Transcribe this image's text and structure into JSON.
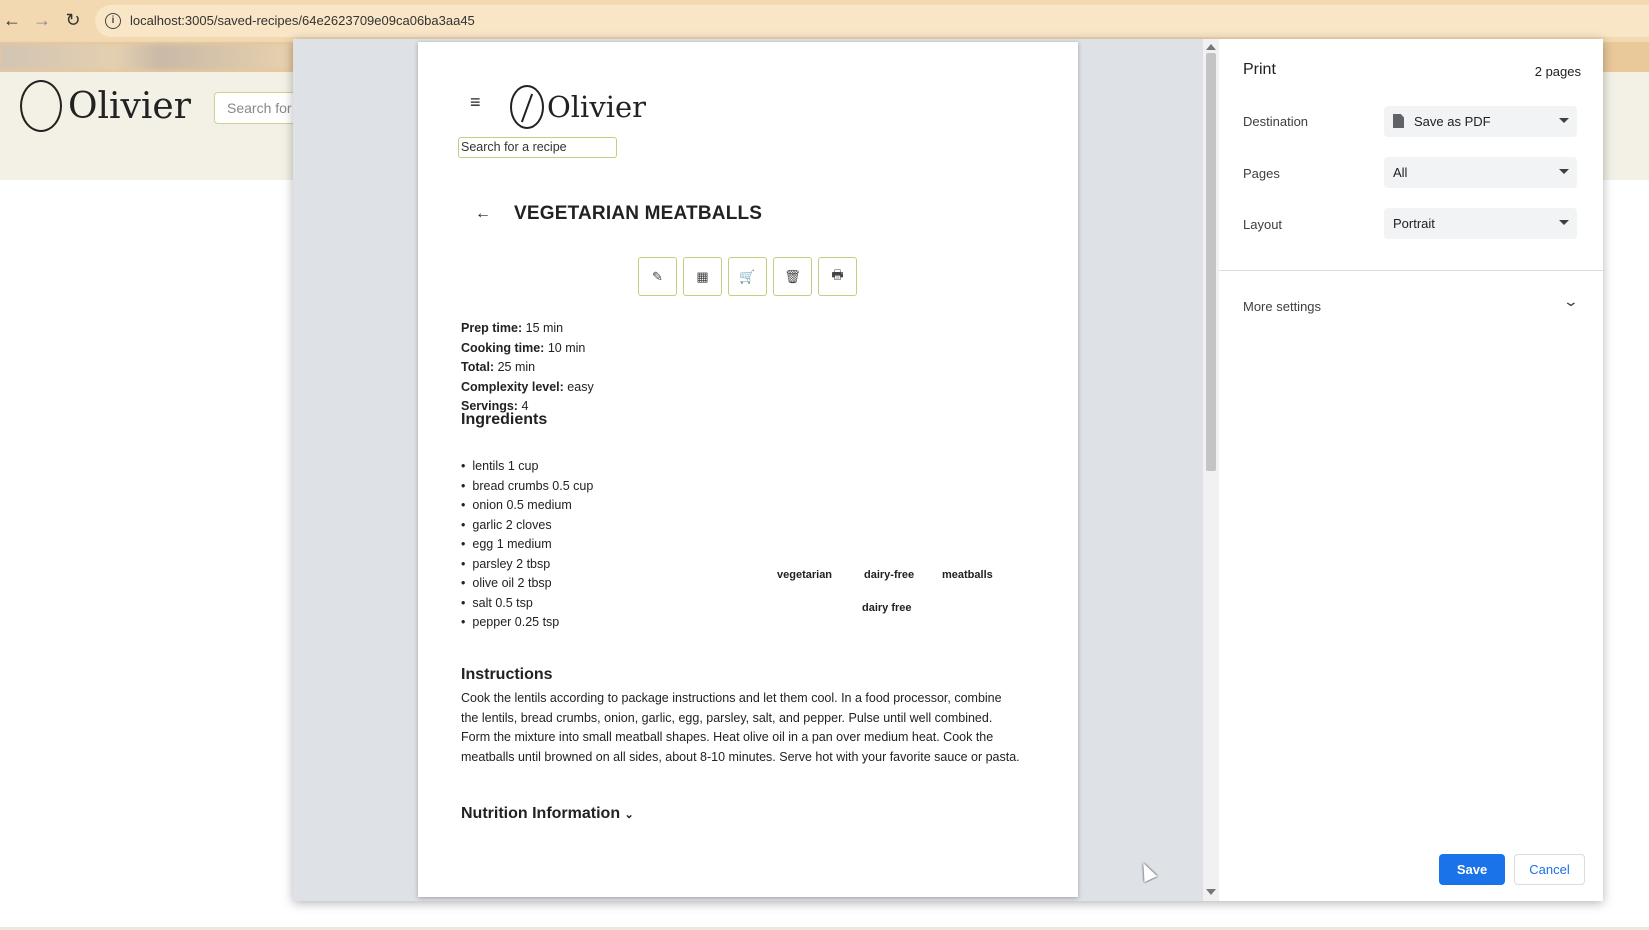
{
  "browser": {
    "url": "localhost:3005/saved-recipes/64e2623709e09ca06ba3aa45",
    "back_icon": "←",
    "forward_icon": "→",
    "reload_icon": "↻"
  },
  "background_page": {
    "brand": "Olivier",
    "search_placeholder": "Search for"
  },
  "preview": {
    "brand": "Olivier",
    "menu_icon": "≡",
    "search_text": "Search for a recipe",
    "back_icon": "←",
    "title": "VEGETARIAN MEATBALLS",
    "actions": [
      "✎",
      "▦",
      "🛒",
      "🗑",
      "🖶"
    ],
    "meta": [
      {
        "label": "Prep time:",
        "value": " 15 min"
      },
      {
        "label": "Cooking time:",
        "value": " 10 min"
      },
      {
        "label": "Total:",
        "value": " 25 min"
      },
      {
        "label": "Complexity level:",
        "value": " easy"
      },
      {
        "label": "Servings:",
        "value": " 4"
      }
    ],
    "ingredients_heading": "Ingredients",
    "ingredients": [
      "lentils 1 cup",
      "bread crumbs 0.5 cup",
      "onion 0.5 medium",
      "garlic 2 cloves",
      "egg 1 medium",
      "parsley 2 tbsp",
      "olive oil 2 tbsp",
      "salt 0.5 tsp",
      "pepper 0.25 tsp"
    ],
    "tags": [
      "vegetarian",
      "dairy-free",
      "meatballs",
      "dairy free"
    ],
    "instructions_heading": "Instructions",
    "instructions": "Cook the lentils according to package instructions and let them cool. In a food processor, combine the lentils, bread crumbs, onion, garlic, egg, parsley, salt, and pepper. Pulse until well combined. Form the mixture into small meatball shapes. Heat olive oil in a pan over medium heat. Cook the meatballs until browned on all sides, about 8-10 minutes. Serve hot with your favorite sauce or pasta.",
    "nutrition_heading": "Nutrition Information",
    "nutrition_caret": "⌄"
  },
  "print_panel": {
    "title": "Print",
    "page_count": "2 pages",
    "destination_label": "Destination",
    "destination_value": "Save as PDF",
    "pages_label": "Pages",
    "pages_value": "All",
    "layout_label": "Layout",
    "layout_value": "Portrait",
    "more_settings": "More settings",
    "more_chevron": "⌄",
    "save_label": "Save",
    "cancel_label": "Cancel"
  },
  "colors": {
    "accent": "#1a73e8",
    "chrome_bar": "#f2d9b1",
    "header_bg": "#f3f1e6",
    "preview_bg": "#dee1e6"
  }
}
